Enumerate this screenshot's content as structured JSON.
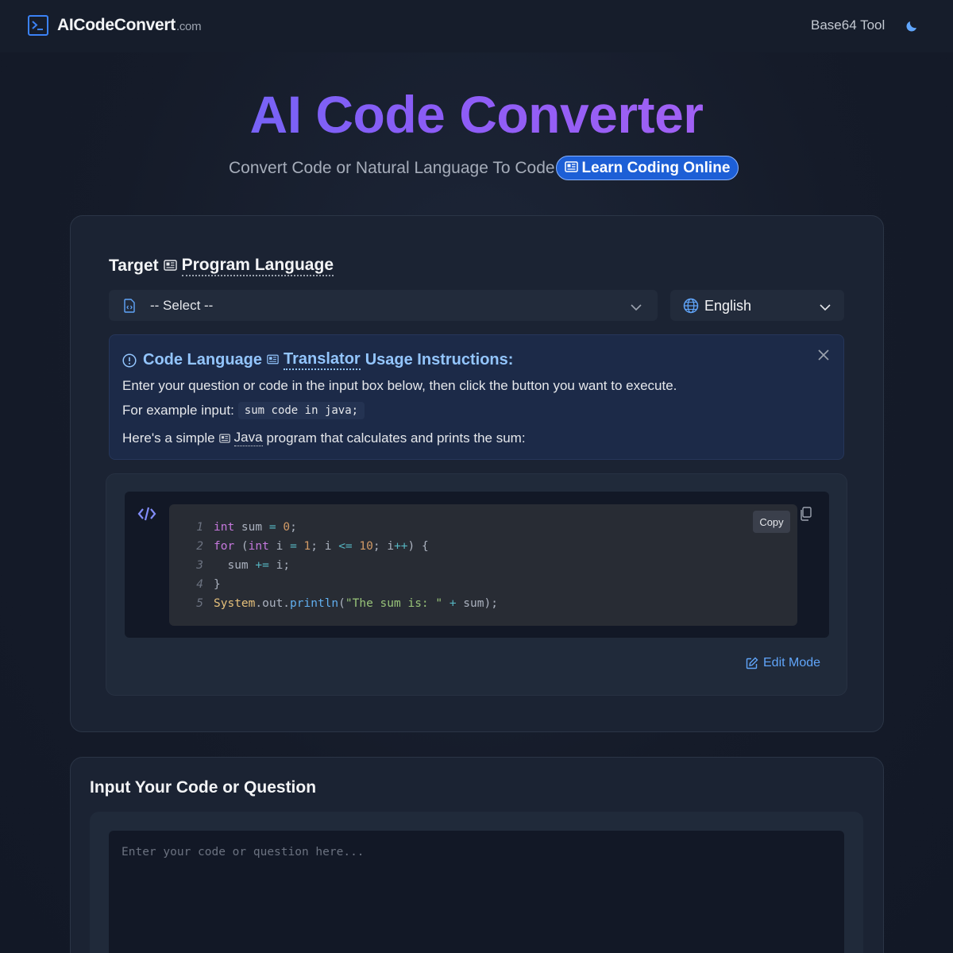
{
  "header": {
    "logo_text": "AICodeConvert",
    "logo_domain": ".com",
    "nav_link": "Base64 Tool",
    "theme_icon": "moon-icon"
  },
  "hero": {
    "title": "AI Code Converter",
    "subtitle": "Convert Code or Natural Language To Code",
    "pill_label": "Learn Coding Online"
  },
  "target": {
    "label_prefix": "Target",
    "label_link": "Program Language",
    "select_value": "-- Select --",
    "language_value": "English"
  },
  "instructions": {
    "title_prefix": "Code Language",
    "title_link": "Translator",
    "title_suffix": "Usage Instructions:",
    "line1": "Enter your question or code in the input box below, then click the button you want to execute.",
    "line2_label": "For example input:",
    "line2_code": "sum code in java;",
    "line3_prefix": "Here's a simple",
    "line3_link": "Java",
    "line3_suffix": "program that calculates and prints the sum:"
  },
  "code_example": {
    "copy_label": "Copy",
    "edit_label": "Edit Mode",
    "line_numbers": [
      "1",
      "2",
      "3",
      "4",
      "5"
    ],
    "lines": [
      "int sum = 0;",
      "for (int i = 1; i <= 10; i++) {",
      "  sum += i;",
      "}",
      "System.out.println(\"The sum is: \" + sum);"
    ]
  },
  "input": {
    "title": "Input Your Code or Question",
    "placeholder": "Enter your code or question here...",
    "value": ""
  },
  "colors": {
    "accent_blue": "#3b82f6",
    "title_gradient_start": "#5b6cf5",
    "title_gradient_end": "#b565f2",
    "pill_bg": "#1d5fd6"
  }
}
